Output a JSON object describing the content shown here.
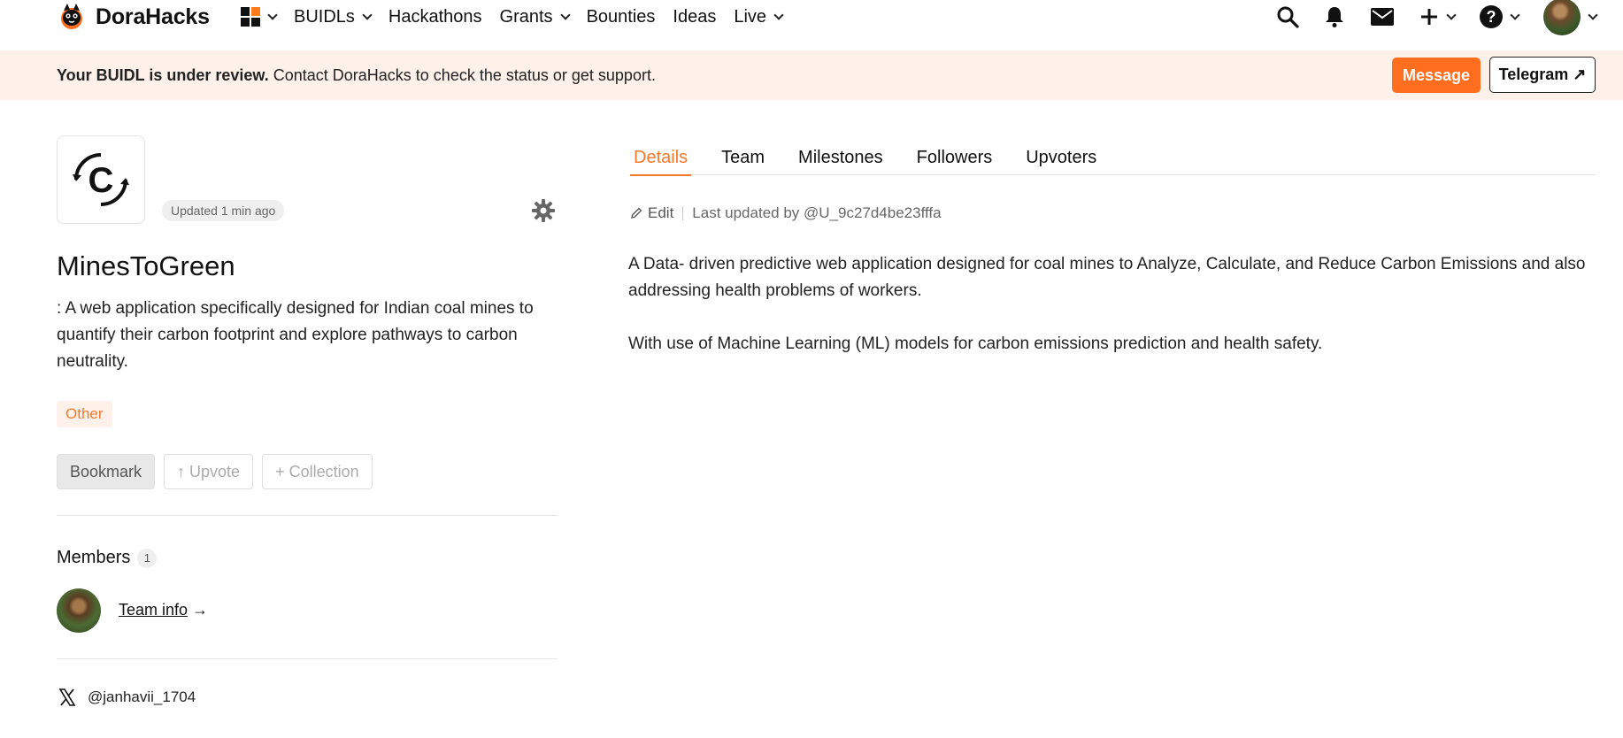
{
  "nav": {
    "brand": "DoraHacks",
    "menu": [
      {
        "label": "BUIDLs",
        "dropdown": true
      },
      {
        "label": "Hackathons",
        "dropdown": false
      },
      {
        "label": "Grants",
        "dropdown": true
      },
      {
        "label": "Bounties",
        "dropdown": false
      },
      {
        "label": "Ideas",
        "dropdown": false
      },
      {
        "label": "Live",
        "dropdown": true
      }
    ],
    "icons": [
      "apps-grid-icon",
      "search-icon",
      "bell-icon",
      "mail-icon",
      "plus-icon",
      "help-icon",
      "user-avatar"
    ],
    "help_glyph": "?"
  },
  "banner": {
    "strong": "Your BUIDL is under review.",
    "text": " Contact DoraHacks to check the status or get support.",
    "message_label": "Message",
    "telegram_label": "Telegram ↗"
  },
  "project": {
    "updated": "Updated 1 min ago",
    "title": "MinesToGreen",
    "description": ": A web application specifically designed for Indian coal mines to quantify their carbon footprint and explore pathways to carbon neutrality.",
    "tag": "Other",
    "actions": {
      "bookmark": "Bookmark",
      "upvote": "↑ Upvote",
      "collection": "+ Collection"
    },
    "members_title": "Members",
    "members_count": "1",
    "team_info": "Team info",
    "team_arrow": "→",
    "twitter": "@janhavii_1704"
  },
  "tabs": [
    "Details",
    "Team",
    "Milestones",
    "Followers",
    "Upvoters"
  ],
  "active_tab": "Details",
  "details": {
    "edit_label": "Edit",
    "last_updated": "Last updated by @U_9c27d4be23fffa",
    "paragraphs": [
      "A Data- driven predictive web application designed for coal mines to Analyze, Calculate, and Reduce Carbon Emissions and also addressing health problems of workers.",
      "With use of Machine Learning (ML) models for carbon emissions prediction and health safety."
    ]
  },
  "colors": {
    "accent": "#ff6d1f",
    "banner_bg": "#fdf1ea",
    "tab_active": "#f47a2b"
  }
}
